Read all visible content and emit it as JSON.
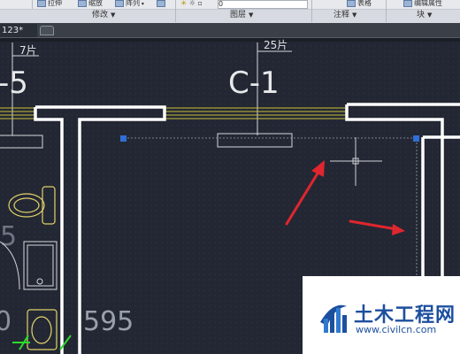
{
  "ribbon": {
    "buttons": [
      {
        "label": "拉伸"
      },
      {
        "label": "缩放"
      },
      {
        "label": "阵列"
      }
    ],
    "layer_value": "0",
    "table_label": "表格",
    "edit_attr_label": "编辑属性",
    "panels": {
      "modify": "修改",
      "layers": "图层",
      "annotate": "注释",
      "block": "块"
    }
  },
  "tabs": {
    "file": "123*"
  },
  "drawing": {
    "labels": {
      "col_left": "-5",
      "col_c1": "C-1",
      "thick_left": "7片",
      "thick_right": "25片",
      "dim_595": "595",
      "dim_0": "0",
      "dim_5": "5"
    },
    "colors": {
      "background": "#232733",
      "wall": "#ffffff",
      "axis_lines": "#c8c23a",
      "fixtures": "#e2d36b",
      "grips": "#2f6fd6",
      "arrows": "#e0262e",
      "crosshair": "#d0d3d8"
    }
  },
  "watermark": {
    "title": "土木工程网",
    "url": "www.civilcn.com"
  }
}
